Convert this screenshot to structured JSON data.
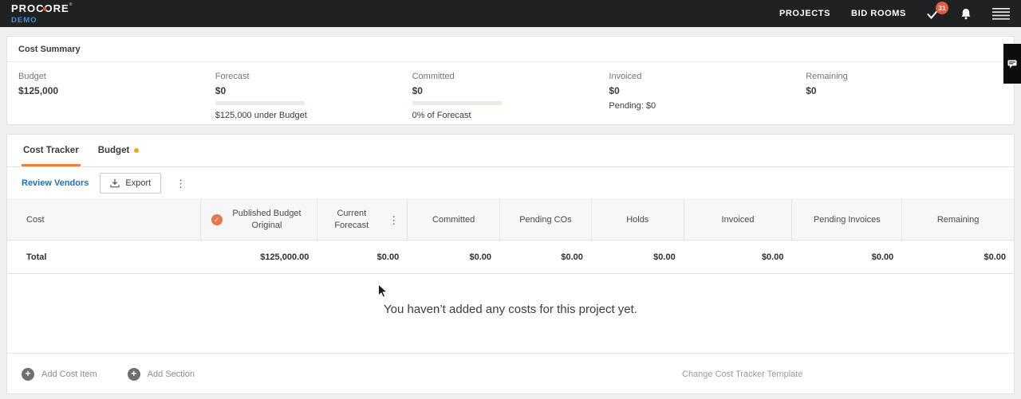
{
  "nav": {
    "logo_text": "PROCORE",
    "logo_sub": "DEMO",
    "items": [
      {
        "label": "PROJECTS"
      },
      {
        "label": "BID ROOMS"
      }
    ],
    "tasks_badge": "31"
  },
  "colors": {
    "accent_orange": "#ef7b45",
    "badge_red": "#e25c3d",
    "budget_dot_yellow": "#f5a623",
    "link_blue": "#1a70c7",
    "nav_bg": "#1f2123"
  },
  "cost_summary": {
    "title": "Cost Summary",
    "metrics": [
      {
        "label": "Budget",
        "value": "$125,000",
        "sub": ""
      },
      {
        "label": "Forecast",
        "value": "$0",
        "sub": "$125,000 under Budget"
      },
      {
        "label": "Committed",
        "value": "$0",
        "sub": "0% of Forecast"
      },
      {
        "label": "Invoiced",
        "value": "$0",
        "sub": "Pending: $0"
      },
      {
        "label": "Remaining",
        "value": "$0",
        "sub": ""
      }
    ]
  },
  "tabs": [
    {
      "label": "Cost Tracker",
      "active": true
    },
    {
      "label": "Budget",
      "active": false
    }
  ],
  "toolbar": {
    "review_vendors_label": "Review Vendors",
    "export_label": "Export",
    "kebab_glyph": "⋮"
  },
  "table": {
    "columns": [
      "Cost",
      "Published Budget Original",
      "Current Forecast",
      "Committed",
      "Pending COs",
      "Holds",
      "Invoiced",
      "Pending Invoices",
      "Remaining"
    ],
    "total_label": "Total",
    "total_values": [
      "$125,000.00",
      "$0.00",
      "$0.00",
      "$0.00",
      "$0.00",
      "$0.00",
      "$0.00",
      "$0.00"
    ]
  },
  "empty_state": {
    "message": "You haven’t added any costs for this project yet."
  },
  "footer": {
    "add_cost_item_label": "Add Cost Item",
    "add_section_label": "Add Section",
    "change_template_label": "Change Cost Tracker Template"
  }
}
